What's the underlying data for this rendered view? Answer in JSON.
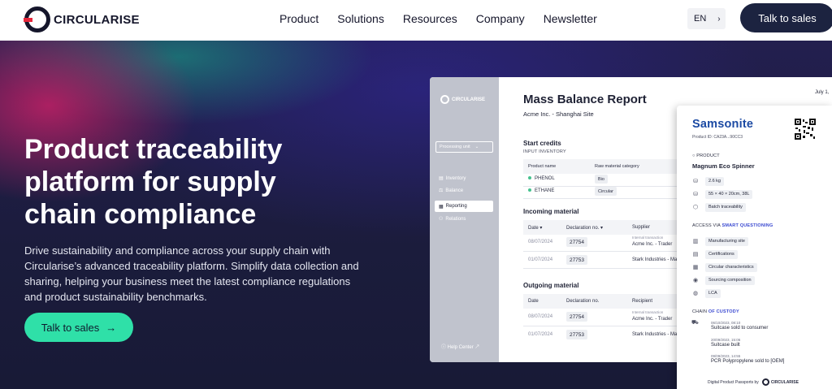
{
  "nav": {
    "logo": "CIRCULARISE",
    "menu": [
      "Product",
      "Solutions",
      "Resources",
      "Company",
      "Newsletter"
    ],
    "lang": "EN",
    "cta": "Talk to sales"
  },
  "hero": {
    "headline": "Product traceability platform for supply chain compliance",
    "lede": "Drive sustainability and compliance across your supply chain with Circularise’s advanced traceability platform. Simplify data collection and sharing, helping your business meet the latest compliance regulations and product sustainability benchmarks.",
    "cta": "Talk to sales"
  },
  "mock": {
    "logo": "CIRCULARISE",
    "processing": "Processing unit",
    "menu": [
      "Inventory",
      "Balance",
      "Reporting",
      "Relations"
    ],
    "help": "Help Center",
    "title": "Mass Balance Report",
    "subtitle": "Acme Inc. - Shanghai Site",
    "date_top": "July 1,",
    "start_credits": "Start credits",
    "input_inventory": "INPUT INVENTORY",
    "inv_cols": [
      "Product name",
      "Raw material category"
    ],
    "inv_rows": [
      {
        "name": "PHENOL",
        "cat": "Bio"
      },
      {
        "name": "ETHANE",
        "cat": "Circular"
      }
    ],
    "incoming": "Incoming material",
    "in_cols": [
      "Date",
      "Declaration no.",
      "Supplier"
    ],
    "in_rows": [
      {
        "date": "08/07/2024",
        "decl": "27754",
        "cap": "Internal transaction",
        "party": "Acme Inc. - Trader"
      },
      {
        "date": "01/07/2024",
        "decl": "27753",
        "cap": "",
        "party": "Stark Industries - Mal"
      }
    ],
    "outgoing": "Outgoing material",
    "out_cols": [
      "Date",
      "Declaration no.",
      "Recipient"
    ],
    "out_rows": [
      {
        "date": "08/07/2024",
        "decl": "27754",
        "cap": "Internal transaction",
        "party": "Acme Inc. - Trader"
      },
      {
        "date": "01/07/2024",
        "decl": "27753",
        "cap": "",
        "party": "Stark Industries - Mal"
      }
    ]
  },
  "card": {
    "brand": "Samsonite",
    "product_id": "Product ID: CA23A...90CC3",
    "product_label": "PRODUCT",
    "product_name": "Magnum Eco Spinner",
    "specs": [
      "2.6 kg",
      "55 × 40 × 20cm, 38L",
      "Batch traceability"
    ],
    "access_label": "ACCESS VIA",
    "access_hl": "SMART QUESTIONING",
    "access_items": [
      "Manufacturing site",
      "Certifications",
      "Circular characteristics",
      "Sourcing composition",
      "LCA"
    ],
    "chain_label": "CHAIN",
    "chain_hl": "OF CUSTODY",
    "chain": [
      {
        "date": "06/10/2023, 08:10",
        "event": "Suitcase sold to consumer"
      },
      {
        "date": "20/09/2023, 15:06",
        "event": "Suitcase built"
      },
      {
        "date": "09/09/2023, 14:55",
        "event": "PCR Polypropylene sold to [OEM]"
      }
    ],
    "footer": "Digital Product Passports by",
    "footer_brand": "CIRCULARISE"
  }
}
